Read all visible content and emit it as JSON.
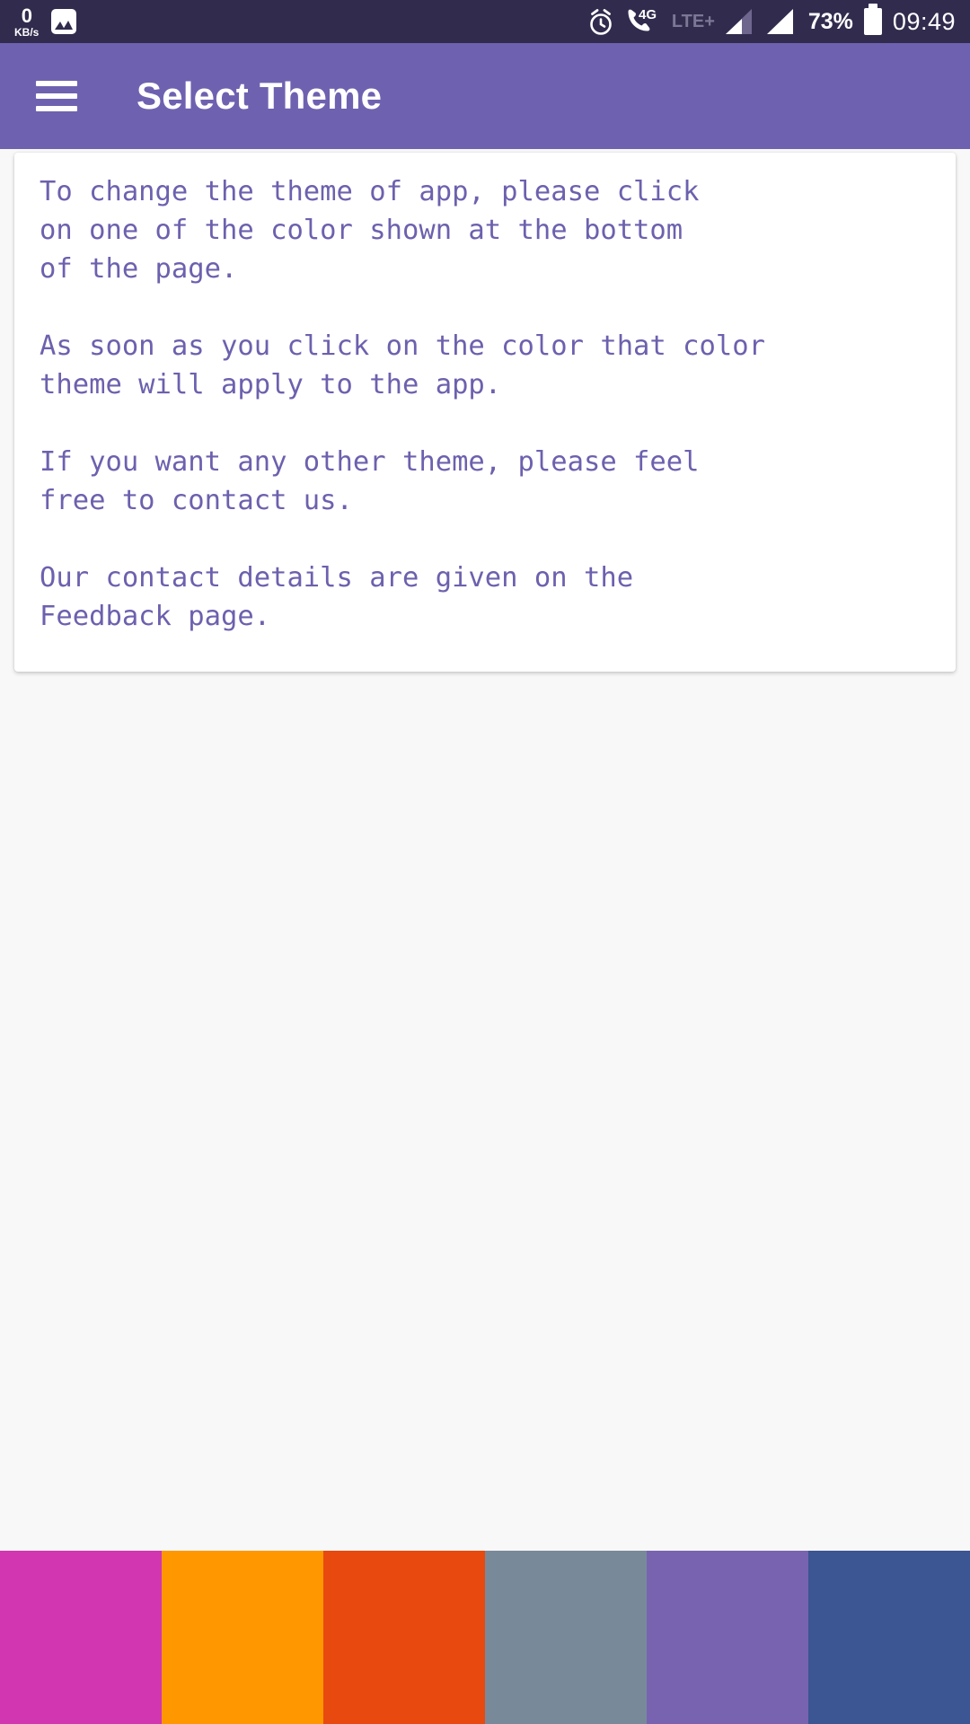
{
  "status_bar": {
    "network_speed_value": "0",
    "network_speed_unit": "KB/s",
    "screenshot_icon": "image-icon",
    "alarm_icon": "alarm-clock-icon",
    "call_icon": "phone-4g-icon",
    "call_badge": "4G",
    "network_type": "LTE+",
    "signal_1_icon": "signal-bars-icon",
    "signal_2_icon": "signal-bars-icon",
    "battery_percent": "73%",
    "battery_icon": "battery-icon",
    "time": "09:49",
    "background_color": "#312C4E"
  },
  "app_bar": {
    "menu_icon": "hamburger-menu-icon",
    "title": "Select Theme",
    "background_color": "#6E62B0",
    "text_color": "#FFFFFF"
  },
  "info_card": {
    "text_color": "#6C61AE",
    "paragraphs": [
      "To change the theme of app, please click\non one of the color shown at the bottom\nof the page.",
      "As soon as you click on the color that color\ntheme will apply to the app.",
      "If you want any other theme, please feel\nfree to contact us.",
      "Our contact details are given on the\nFeedback page."
    ],
    "body": "To change the theme of app, please click\non one of the color shown at the bottom\nof the page.\n\nAs soon as you click on the color that color\ntheme will apply to the app.\n\nIf you want any other theme, please feel\nfree to contact us.\n\nOur contact details are given on the\nFeedback page."
  },
  "theme_swatches": [
    {
      "name": "magenta",
      "color": "#D236B0"
    },
    {
      "name": "orange",
      "color": "#FF9800"
    },
    {
      "name": "deep-orange",
      "color": "#E8490F"
    },
    {
      "name": "blue-grey",
      "color": "#78899A"
    },
    {
      "name": "purple",
      "color": "#7763B0"
    },
    {
      "name": "indigo",
      "color": "#3C5593"
    }
  ],
  "page": {
    "background_color": "#F8F8F8"
  }
}
